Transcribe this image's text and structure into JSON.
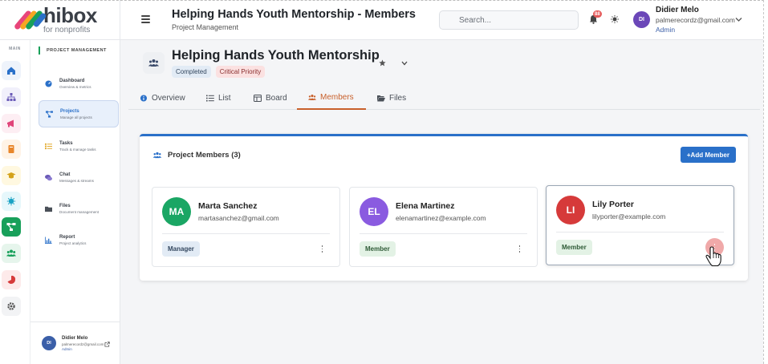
{
  "brand": {
    "name": "hibox",
    "sub": "for nonprofits"
  },
  "rail": {
    "label": "MAIN"
  },
  "nav": {
    "heading": "PROJECT MANAGEMENT",
    "items": [
      {
        "title": "Dashboard",
        "desc": "Overview & metrics"
      },
      {
        "title": "Projects",
        "desc": "Manage all projects"
      },
      {
        "title": "Tasks",
        "desc": "Track & manage tasks"
      },
      {
        "title": "Chat",
        "desc": "Messages & streams"
      },
      {
        "title": "Files",
        "desc": "Document management"
      },
      {
        "title": "Report",
        "desc": "Project analytics"
      }
    ],
    "user": {
      "initials": "DI",
      "name": "Didier Melo",
      "email": "palmerecordz@gmail.com",
      "role": "Admin"
    }
  },
  "header": {
    "title": "Helping Hands Youth Mentorship - Members",
    "subtitle": "Project Management",
    "search_placeholder": "Search...",
    "notifications": "88",
    "user": {
      "initials": "DI",
      "name": "Didier Melo",
      "email": "palmerecordz@gmail.com",
      "role": "Admin"
    }
  },
  "project": {
    "title": "Helping Hands Youth Mentorship",
    "status": "Completed",
    "priority": "Critical Priority"
  },
  "tabs": [
    {
      "label": "Overview"
    },
    {
      "label": "List"
    },
    {
      "label": "Board"
    },
    {
      "label": "Members"
    },
    {
      "label": "Files"
    }
  ],
  "members_panel": {
    "title": "Project Members (3)",
    "add_label": "+Add Member",
    "members": [
      {
        "initials": "MA",
        "name": "Marta Sanchez",
        "email": "martasanchez@gmail.com",
        "role": "Manager",
        "color": "#1aa664"
      },
      {
        "initials": "EL",
        "name": "Elena Martinez",
        "email": "elenamartinez@example.com",
        "role": "Member",
        "color": "#8a5be0"
      },
      {
        "initials": "LI",
        "name": "Lily Porter",
        "email": "lilyporter@example.com",
        "role": "Member",
        "color": "#d63a3a"
      }
    ]
  },
  "colors": {
    "accent": "#2a70c9",
    "active_tab": "#c8602b",
    "brand_green": "#18a05a"
  }
}
